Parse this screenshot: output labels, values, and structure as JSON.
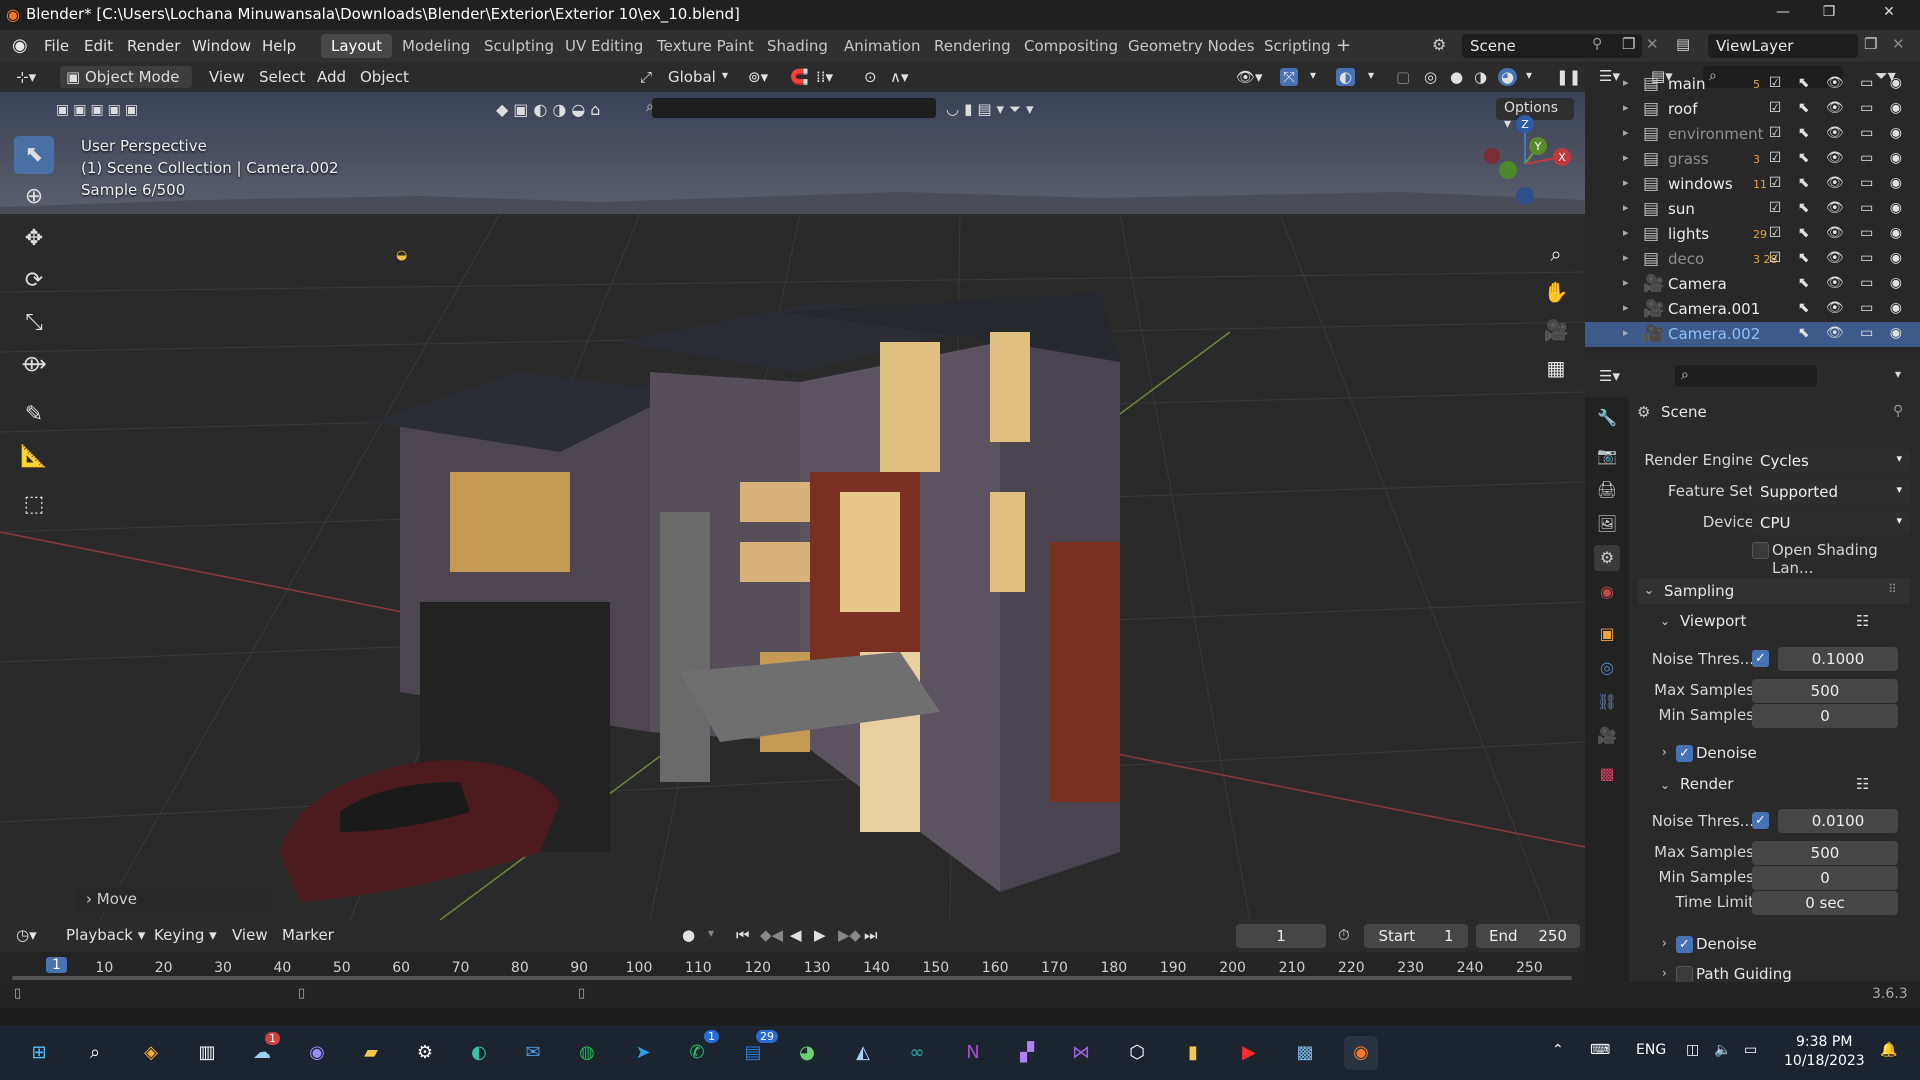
{
  "window": {
    "title": "Blender* [C:\\Users\\Lochana Minuwansala\\Downloads\\Blender\\Exterior\\Exterior 10\\ex_10.blend]"
  },
  "menus": [
    "File",
    "Edit",
    "Render",
    "Window",
    "Help"
  ],
  "workspaces": [
    "Layout",
    "Modeling",
    "Sculpting",
    "UV Editing",
    "Texture Paint",
    "Shading",
    "Animation",
    "Rendering",
    "Compositing",
    "Geometry Nodes",
    "Scripting"
  ],
  "active_workspace": "Layout",
  "scene_name": "Scene",
  "view_layer": "ViewLayer",
  "viewport_header": {
    "mode": "Object Mode",
    "menu": [
      "View",
      "Select",
      "Add",
      "Object"
    ],
    "transform": "Global",
    "options": "Options"
  },
  "viewport": {
    "perspective": "User Perspective",
    "collection": "(1) Scene Collection | Camera.002",
    "sample": "Sample 6/500",
    "last_op": "Move",
    "gizmo": {
      "z": "Z",
      "y": "Y",
      "x": "X"
    }
  },
  "outliner": {
    "rows": [
      {
        "name": "main",
        "badge": "5",
        "dim": false,
        "sel": false
      },
      {
        "name": "roof",
        "badge": "",
        "dim": false,
        "sel": false
      },
      {
        "name": "environment",
        "badge": "",
        "dim": true,
        "sel": false
      },
      {
        "name": "grass",
        "badge": "3",
        "dim": true,
        "sel": false
      },
      {
        "name": "windows",
        "badge": "11",
        "dim": false,
        "sel": false
      },
      {
        "name": "sun",
        "badge": "",
        "dim": false,
        "sel": false
      },
      {
        "name": "lights",
        "badge": "29",
        "dim": false,
        "sel": false
      },
      {
        "name": "deco",
        "badge": "3  28",
        "dim": true,
        "sel": false
      },
      {
        "name": "Camera",
        "badge": "",
        "dim": false,
        "sel": false
      },
      {
        "name": "Camera.001",
        "badge": "",
        "dim": false,
        "sel": false
      },
      {
        "name": "Camera.002",
        "badge": "",
        "dim": false,
        "sel": true
      }
    ]
  },
  "properties": {
    "context": "Scene",
    "render_engine_label": "Render Engine",
    "render_engine": "Cycles",
    "feature_set_label": "Feature Set",
    "feature_set": "Supported",
    "device_label": "Device",
    "device": "CPU",
    "osl": "Open Shading Lan...",
    "sampling": "Sampling",
    "viewport": "Viewport",
    "noise_label": "Noise Thres...",
    "vp_noise": "0.1000",
    "max_samples_label": "Max Samples",
    "vp_max": "500",
    "min_samples_label": "Min Samples",
    "vp_min": "0",
    "denoise": "Denoise",
    "render": "Render",
    "r_noise": "0.0100",
    "r_max": "500",
    "r_min": "0",
    "time_limit_label": "Time Limit",
    "time_limit": "0 sec",
    "r_denoise": "Denoise",
    "path_guiding": "Path Guiding"
  },
  "timeline": {
    "menus": [
      "Playback",
      "Keying",
      "View",
      "Marker"
    ],
    "current_frame": "1",
    "start_label": "Start",
    "start": "1",
    "end_label": "End",
    "end": "250",
    "ticks": [
      "1",
      "10",
      "20",
      "30",
      "40",
      "50",
      "60",
      "70",
      "80",
      "90",
      "100",
      "110",
      "120",
      "130",
      "140",
      "150",
      "160",
      "170",
      "180",
      "190",
      "200",
      "210",
      "220",
      "230",
      "240",
      "250"
    ]
  },
  "status": {
    "version": "3.6.3"
  },
  "taskbar": {
    "lang": "ENG",
    "time": "9:38 PM",
    "date": "10/18/2023",
    "badge_weather": "1",
    "badge_whatsapp": "1",
    "badge_mail": "29"
  },
  "colors": {
    "accent": "#4772b3",
    "selection": "#3d5a8a",
    "active_tab": "#474747"
  }
}
